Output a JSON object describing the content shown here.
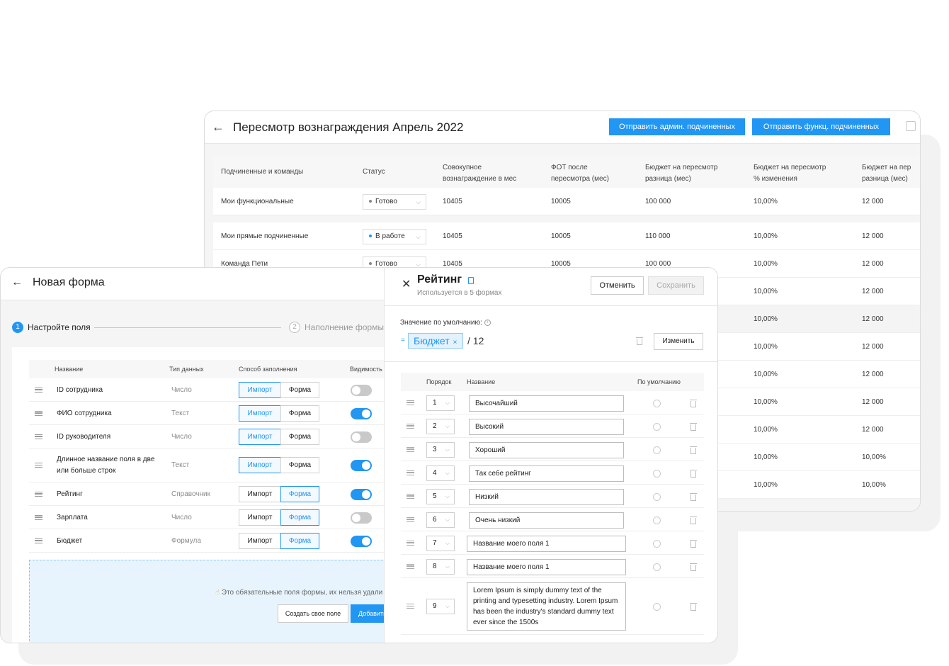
{
  "back_window": {
    "title": "Пересмотр вознаграждения Апрель 2022",
    "btn_admin": "Отправить админ. подчиненных",
    "btn_func": "Отправить функц. подчиненных",
    "headers": [
      "Подчиненные и команды",
      "Статус",
      "Совокупное вознаграждение в мес",
      "ФОТ после пересмотра (мес)",
      "Бюджет на пересмотр разница (мес)",
      "Бюджет на пересмотр % изменения",
      "Бюджет на пер разница (мес)"
    ],
    "rows": [
      {
        "name": "Мои функциональные",
        "status": "Готово",
        "total": "10405",
        "fot": "10005",
        "budget": "100 000",
        "pct": "10,00%",
        "diff": "12 000"
      },
      {
        "name": "Мои прямые подчиненные",
        "status": "В работе",
        "total": "10405",
        "fot": "10005",
        "budget": "110 000",
        "pct": "10,00%",
        "diff": "12 000"
      },
      {
        "name": "Команда Пети",
        "status": "Готово",
        "total": "10405",
        "fot": "10005",
        "budget": "100 000",
        "pct": "10,00%",
        "diff": "12 000"
      },
      {
        "pct": "10,00%",
        "diff": "12 000"
      },
      {
        "pct": "10,00%",
        "diff": "12 000"
      },
      {
        "pct": "10,00%",
        "diff": "12 000"
      },
      {
        "pct": "10,00%",
        "diff": "12 000"
      },
      {
        "pct": "10,00%",
        "diff": "12 000"
      },
      {
        "pct": "10,00%",
        "diff": "12 000"
      },
      {
        "pct": "10,00%",
        "diff": "10,00%"
      },
      {
        "pct": "10,00%",
        "diff": "10,00%"
      }
    ]
  },
  "form": {
    "title": "Новая форма",
    "step1_num": "1",
    "step1": "Настройте поля",
    "step2_num": "2",
    "step2": "Наполнение формы",
    "headers": [
      "Название",
      "Тип данных",
      "Способ заполнения",
      "Видимость д"
    ],
    "seg_import": "Импорт",
    "seg_form": "Форма",
    "fields": [
      {
        "name": "ID сотрудника",
        "type": "Число",
        "fill": "import",
        "visible": false
      },
      {
        "name": "ФИО сотрудника",
        "type": "Текст",
        "fill": "import",
        "visible": true
      },
      {
        "name": "ID руководителя",
        "type": "Число",
        "fill": "import",
        "visible": false
      },
      {
        "name": "Длинное название поля в две или больше строк",
        "type": "Текст",
        "fill": "import",
        "visible": true
      },
      {
        "name": "Рейтинг",
        "type": "Справочник",
        "fill": "form",
        "visible": true
      },
      {
        "name": "Зарплата",
        "type": "Число",
        "fill": "form",
        "visible": false
      },
      {
        "name": "Бюджет",
        "type": "Формула",
        "fill": "form",
        "visible": true
      }
    ],
    "dropzone_text": "Это обязательные поля формы, их нельзя удали",
    "btn_create": "Создать свое поле",
    "btn_add": "Добавить"
  },
  "panel": {
    "title": "Рейтинг",
    "subtitle": "Используется в 5 формах",
    "btn_cancel": "Отменить",
    "btn_save": "Сохранить",
    "default_label": "Значение по умолчанию:",
    "eq": "=",
    "tag": "Бюджет",
    "tag_x": "×",
    "divider": "/ 12",
    "btn_change": "Изменить",
    "headers": [
      "Порядок",
      "Название",
      "По умолчанию"
    ],
    "items": [
      {
        "order": "1",
        "name": "Высочайший"
      },
      {
        "order": "2",
        "name": "Высокий"
      },
      {
        "order": "3",
        "name": "Хороший"
      },
      {
        "order": "4",
        "name": "Так себе рейтинг"
      },
      {
        "order": "5",
        "name": "Низкий"
      },
      {
        "order": "6",
        "name": "Очень низкий"
      },
      {
        "order": "7",
        "name": "Название моего поля 1"
      },
      {
        "order": "8",
        "name": "Название моего поля 1"
      },
      {
        "order": "9",
        "name": "Lorem Ipsum is simply dummy text of the printing and typesetting industry. Lorem Ipsum has been the industry's standard dummy text ever since the 1500s"
      }
    ]
  }
}
